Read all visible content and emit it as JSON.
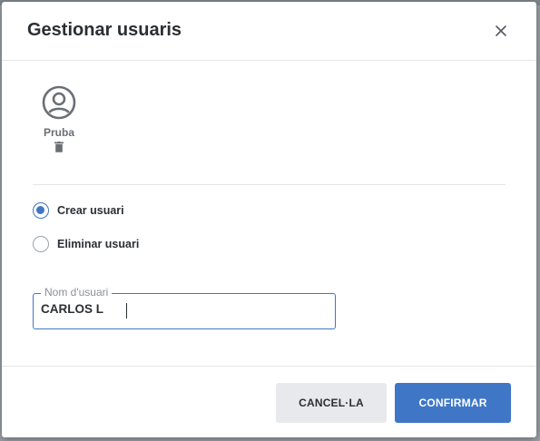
{
  "dialog": {
    "title": "Gestionar usuaris",
    "close_icon": "close-icon"
  },
  "user": {
    "name": "Pruba",
    "avatar_icon": "user-circle-icon",
    "delete_icon": "trash-icon"
  },
  "options": [
    {
      "label": "Crear usuari",
      "checked": true
    },
    {
      "label": "Eliminar usuari",
      "checked": false
    }
  ],
  "username_field": {
    "label": "Nom d'usuari",
    "value": "CARLOS L"
  },
  "footer": {
    "cancel_label": "CANCEL·LA",
    "confirm_label": "CONFIRMAR"
  },
  "colors": {
    "accent": "#3f77c6",
    "cancel_bg": "#e7e9ec"
  }
}
